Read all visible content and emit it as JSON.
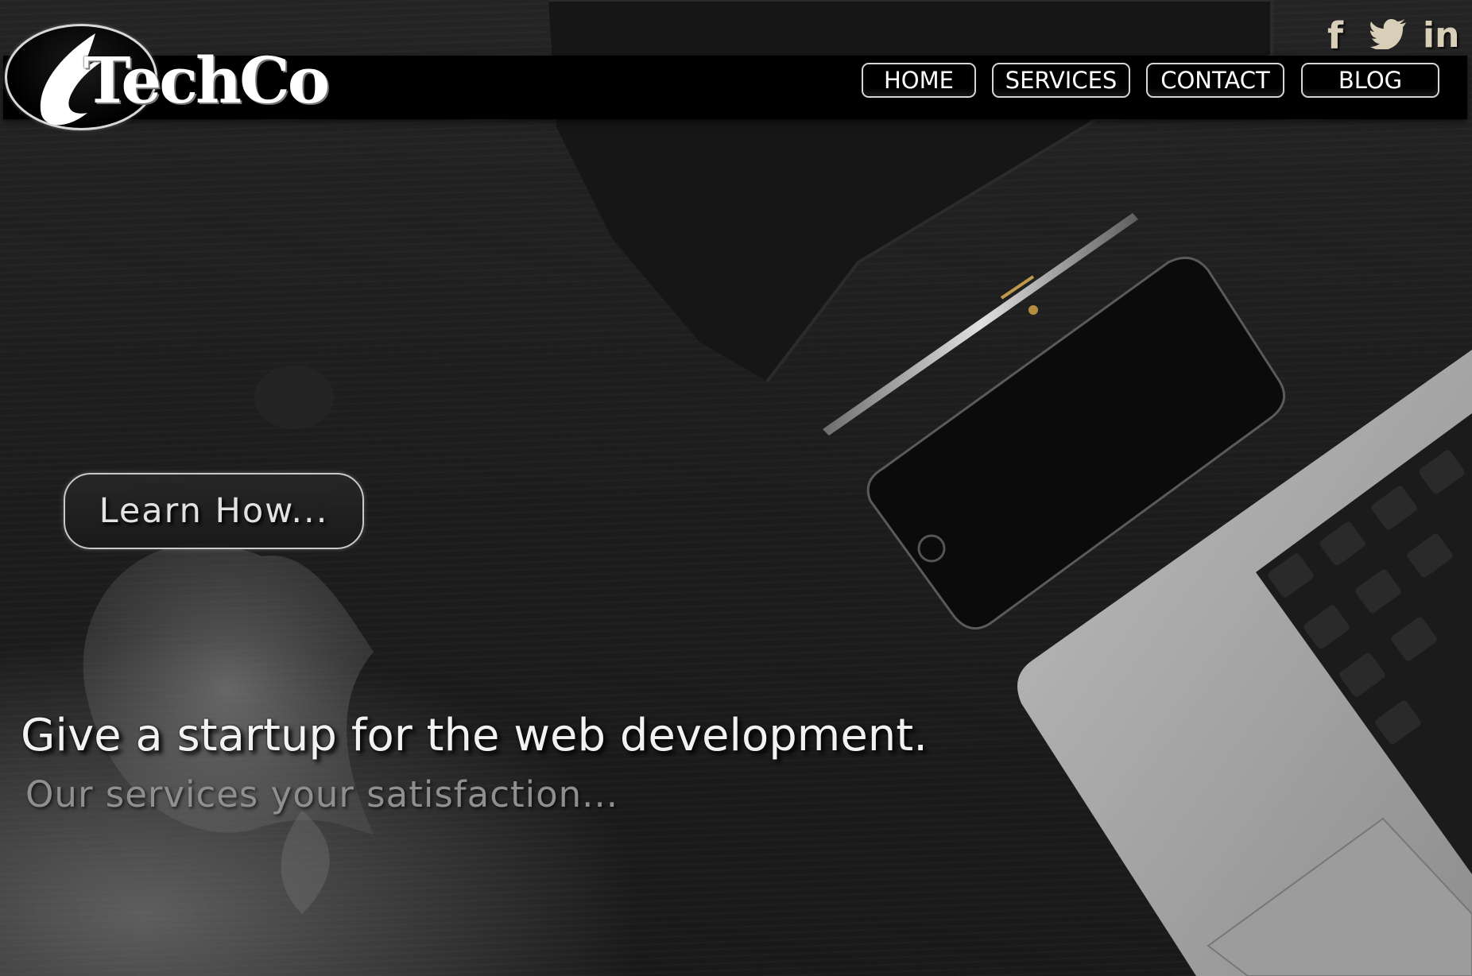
{
  "brand": {
    "name": "TechCo"
  },
  "social": {
    "facebook": "f",
    "linkedin": "in"
  },
  "nav": {
    "items": [
      {
        "label": "HOME"
      },
      {
        "label": "SERVICES"
      },
      {
        "label": "CONTACT"
      },
      {
        "label": "BLOG"
      }
    ]
  },
  "hero": {
    "cta_label": "Learn How...",
    "headline": "Give a startup for the web development.",
    "subline": "Our services your satisfaction..."
  },
  "colors": {
    "header": "#000000",
    "background": "#1d1d1d",
    "social_icons": "#d9cfb9",
    "headline": "#f2f2f2",
    "subline": "#8f8f8f"
  },
  "icons": [
    "facebook-icon",
    "twitter-icon",
    "linkedin-icon",
    "logo-flame-icon"
  ]
}
